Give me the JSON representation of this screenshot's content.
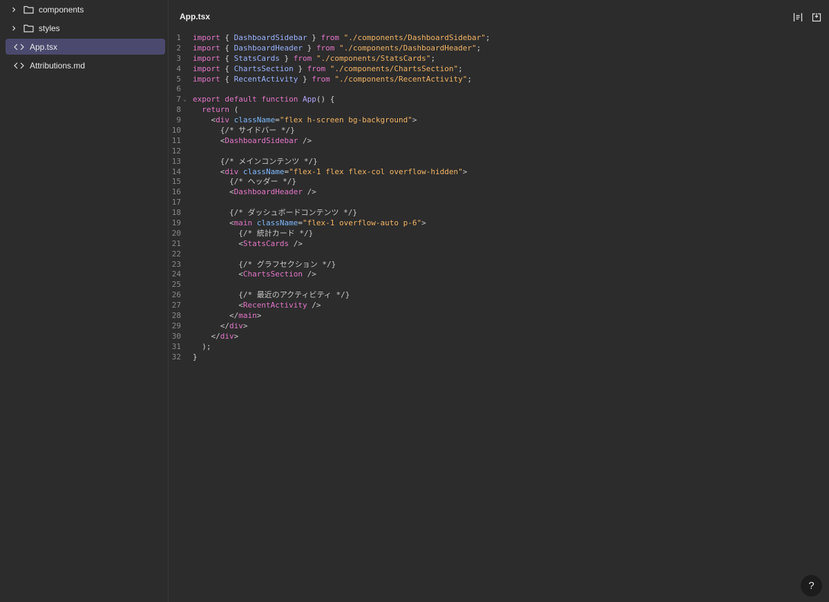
{
  "sidebar": {
    "items": [
      {
        "label": "components",
        "kind": "folder",
        "icon": "folder-icon"
      },
      {
        "label": "styles",
        "kind": "folder",
        "icon": "folder-icon"
      },
      {
        "label": "App.tsx",
        "kind": "file",
        "icon": "code-icon",
        "active": true
      },
      {
        "label": "Attributions.md",
        "kind": "file",
        "icon": "code-icon"
      }
    ]
  },
  "editor": {
    "title": "App.tsx",
    "icons": [
      "format-icon",
      "export-icon"
    ],
    "lines": [
      {
        "n": "1",
        "text": "import { DashboardSidebar } from \"./components/DashboardSidebar\";"
      },
      {
        "n": "2",
        "text": "import { DashboardHeader } from \"./components/DashboardHeader\";"
      },
      {
        "n": "3",
        "text": "import { StatsCards } from \"./components/StatsCards\";"
      },
      {
        "n": "4",
        "text": "import { ChartsSection } from \"./components/ChartsSection\";"
      },
      {
        "n": "5",
        "text": "import { RecentActivity } from \"./components/RecentActivity\";"
      },
      {
        "n": "6",
        "text": ""
      },
      {
        "n": "7",
        "text": "export default function App() {"
      },
      {
        "n": "8",
        "text": "  return ("
      },
      {
        "n": "9",
        "text": "    <div className=\"flex h-screen bg-background\">"
      },
      {
        "n": "10",
        "text": "      {/* サイドバー */}"
      },
      {
        "n": "11",
        "text": "      <DashboardSidebar />"
      },
      {
        "n": "12",
        "text": ""
      },
      {
        "n": "13",
        "text": "      {/* メインコンテンツ */}"
      },
      {
        "n": "14",
        "text": "      <div className=\"flex-1 flex flex-col overflow-hidden\">"
      },
      {
        "n": "15",
        "text": "        {/* ヘッダー */}"
      },
      {
        "n": "16",
        "text": "        <DashboardHeader />"
      },
      {
        "n": "17",
        "text": ""
      },
      {
        "n": "18",
        "text": "        {/* ダッシュボードコンテンツ */}"
      },
      {
        "n": "19",
        "text": "        <main className=\"flex-1 overflow-auto p-6\">"
      },
      {
        "n": "20",
        "text": "          {/* 統計カード */}"
      },
      {
        "n": "21",
        "text": "          <StatsCards />"
      },
      {
        "n": "22",
        "text": ""
      },
      {
        "n": "23",
        "text": "          {/* グラフセクション */}"
      },
      {
        "n": "24",
        "text": "          <ChartsSection />"
      },
      {
        "n": "25",
        "text": ""
      },
      {
        "n": "26",
        "text": "          {/* 最近のアクティビティ */}"
      },
      {
        "n": "27",
        "text": "          <RecentActivity />"
      },
      {
        "n": "28",
        "text": "        </main>"
      },
      {
        "n": "29",
        "text": "      </div>"
      },
      {
        "n": "30",
        "text": "    </div>"
      },
      {
        "n": "31",
        "text": "  );"
      },
      {
        "n": "32",
        "text": "}"
      }
    ]
  },
  "help": {
    "label": "?"
  },
  "colors": {
    "background": "#2c2c2c",
    "active_item": "#4b4a6e",
    "keyword": "#e576c9",
    "identifier": "#9ab3ff",
    "string": "#f3b464",
    "attribute": "#7fb9ff"
  }
}
